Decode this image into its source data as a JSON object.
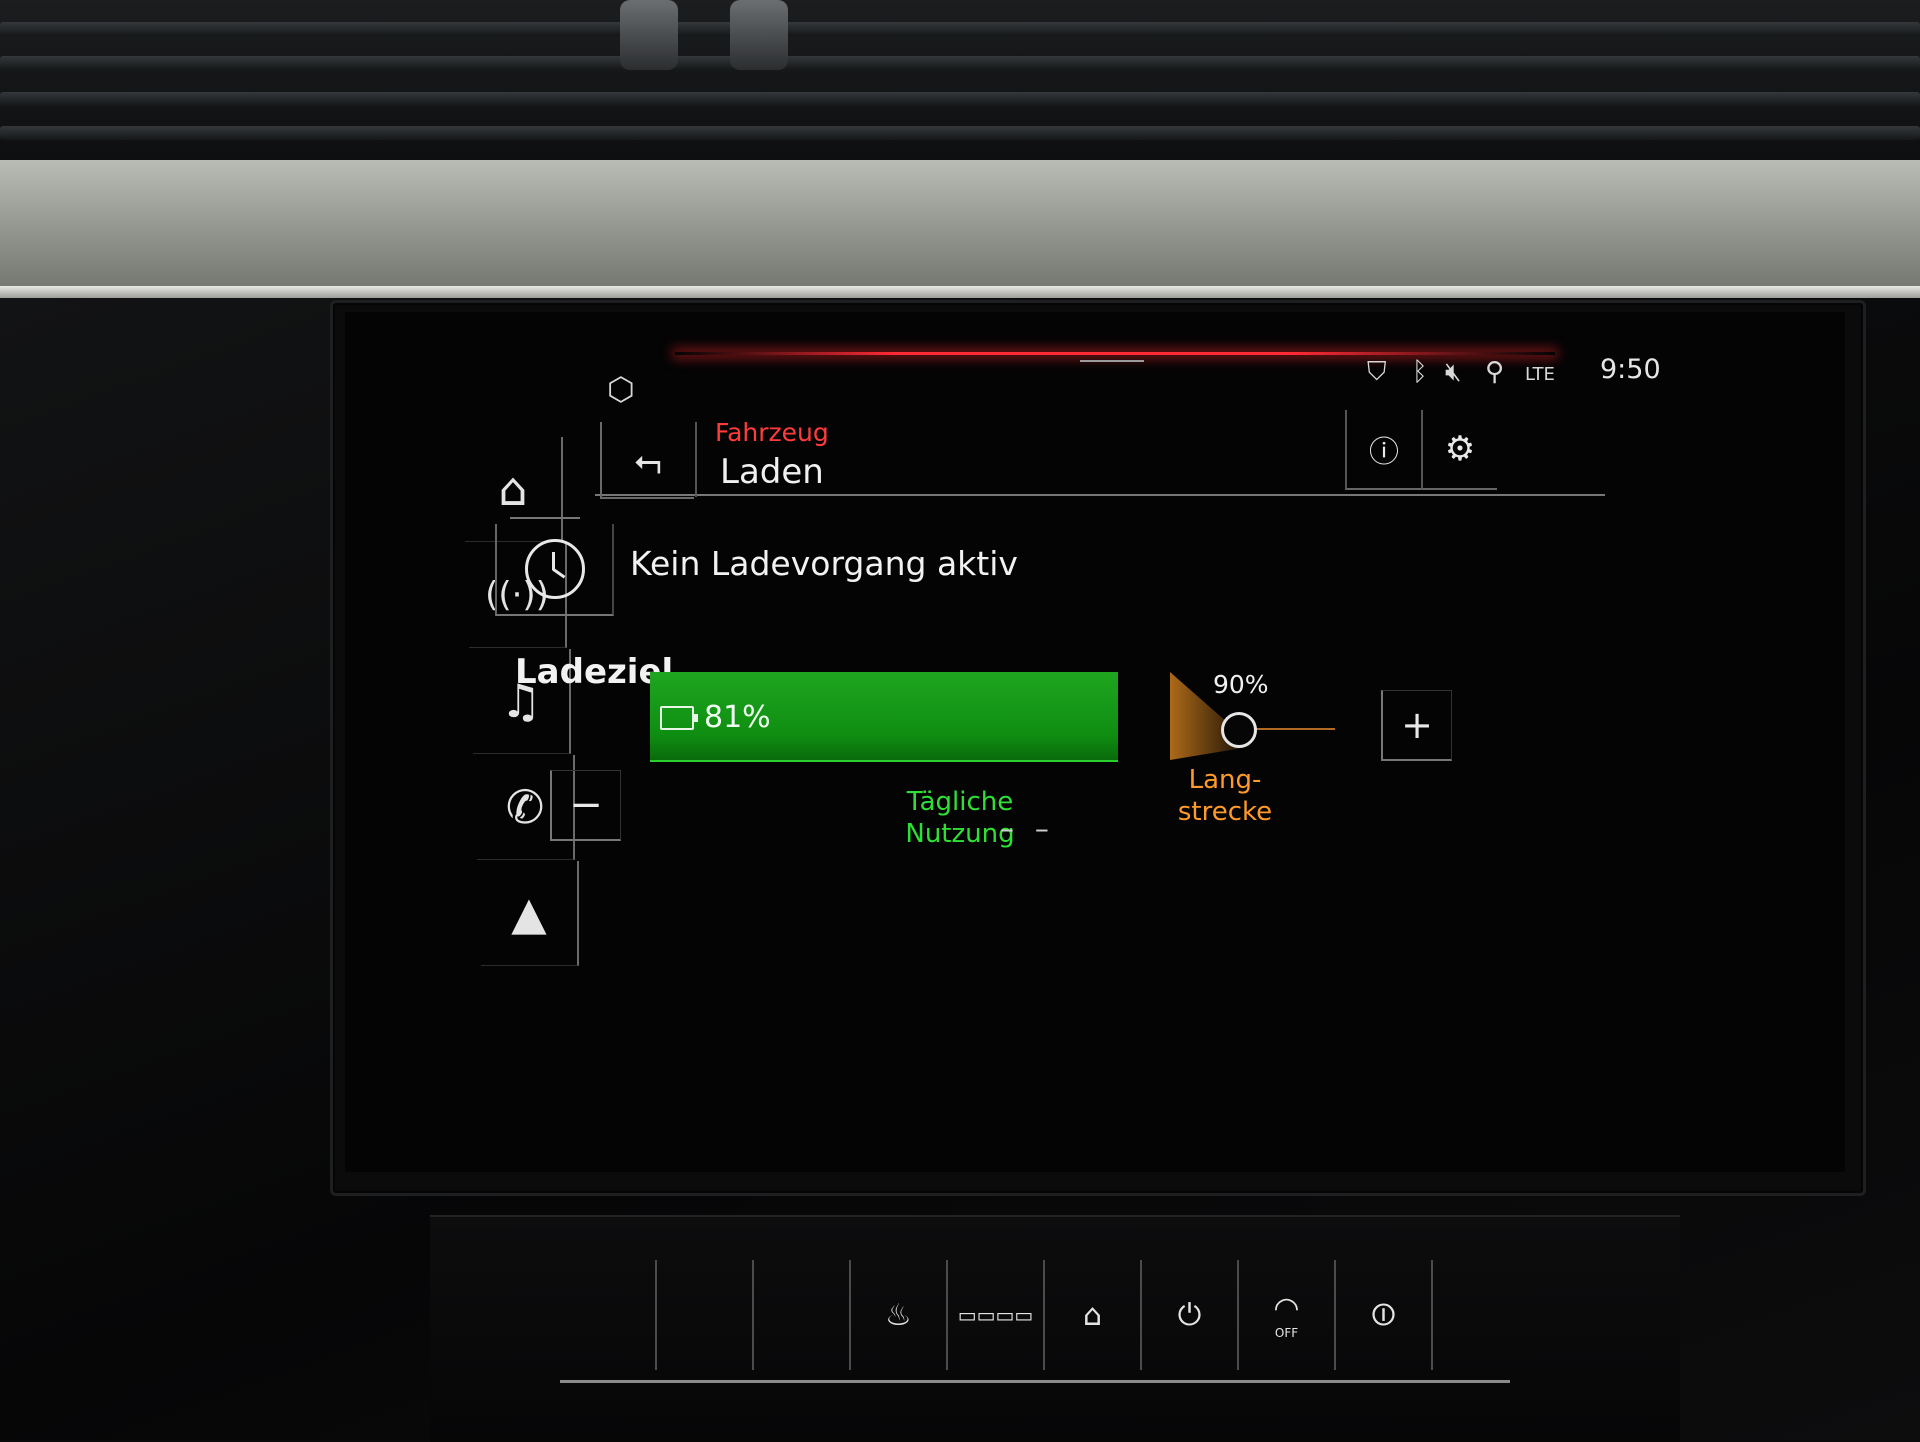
{
  "statusbar": {
    "icons": [
      "shield-location-icon",
      "bluetooth-icon",
      "mute-icon",
      "user-icon",
      "lte-signal-icon"
    ],
    "time": "9:50"
  },
  "nav": {
    "items": [
      {
        "name": "home",
        "icon": "home-icon"
      },
      {
        "name": "radio",
        "icon": "antenna-icon"
      },
      {
        "name": "media",
        "icon": "music-note-icon"
      },
      {
        "name": "phone",
        "icon": "phone-icon"
      },
      {
        "name": "navigation",
        "icon": "navigation-arrow-icon"
      }
    ]
  },
  "header": {
    "breadcrumb": "Fahrzeug",
    "title": "Laden"
  },
  "charging": {
    "status": "Kein Ladevorgang aktiv",
    "target_heading": "Ladeziel",
    "current_percent_label": "81%",
    "current_level": 0.81,
    "target_label": "90%",
    "target_level": 0.9,
    "daily_label_line1": "Tägliche",
    "daily_label_line2": "Nutzung",
    "long_label_line1": "Lang-",
    "long_label_line2": "strecke",
    "range_placeholder": "– –"
  },
  "colors": {
    "accent_red": "#ff3b3b",
    "bar_green": "#1fa51f",
    "daily_green": "#2fe034",
    "long_orange": "#ff9a2a"
  },
  "climate_buttons": [
    "seat-heating-icon",
    "defrost-grid-icon",
    "home-lift-icon",
    "plug-icon",
    "wiper-off-icon",
    "display-power-icon"
  ],
  "climate_off_label": "OFF"
}
